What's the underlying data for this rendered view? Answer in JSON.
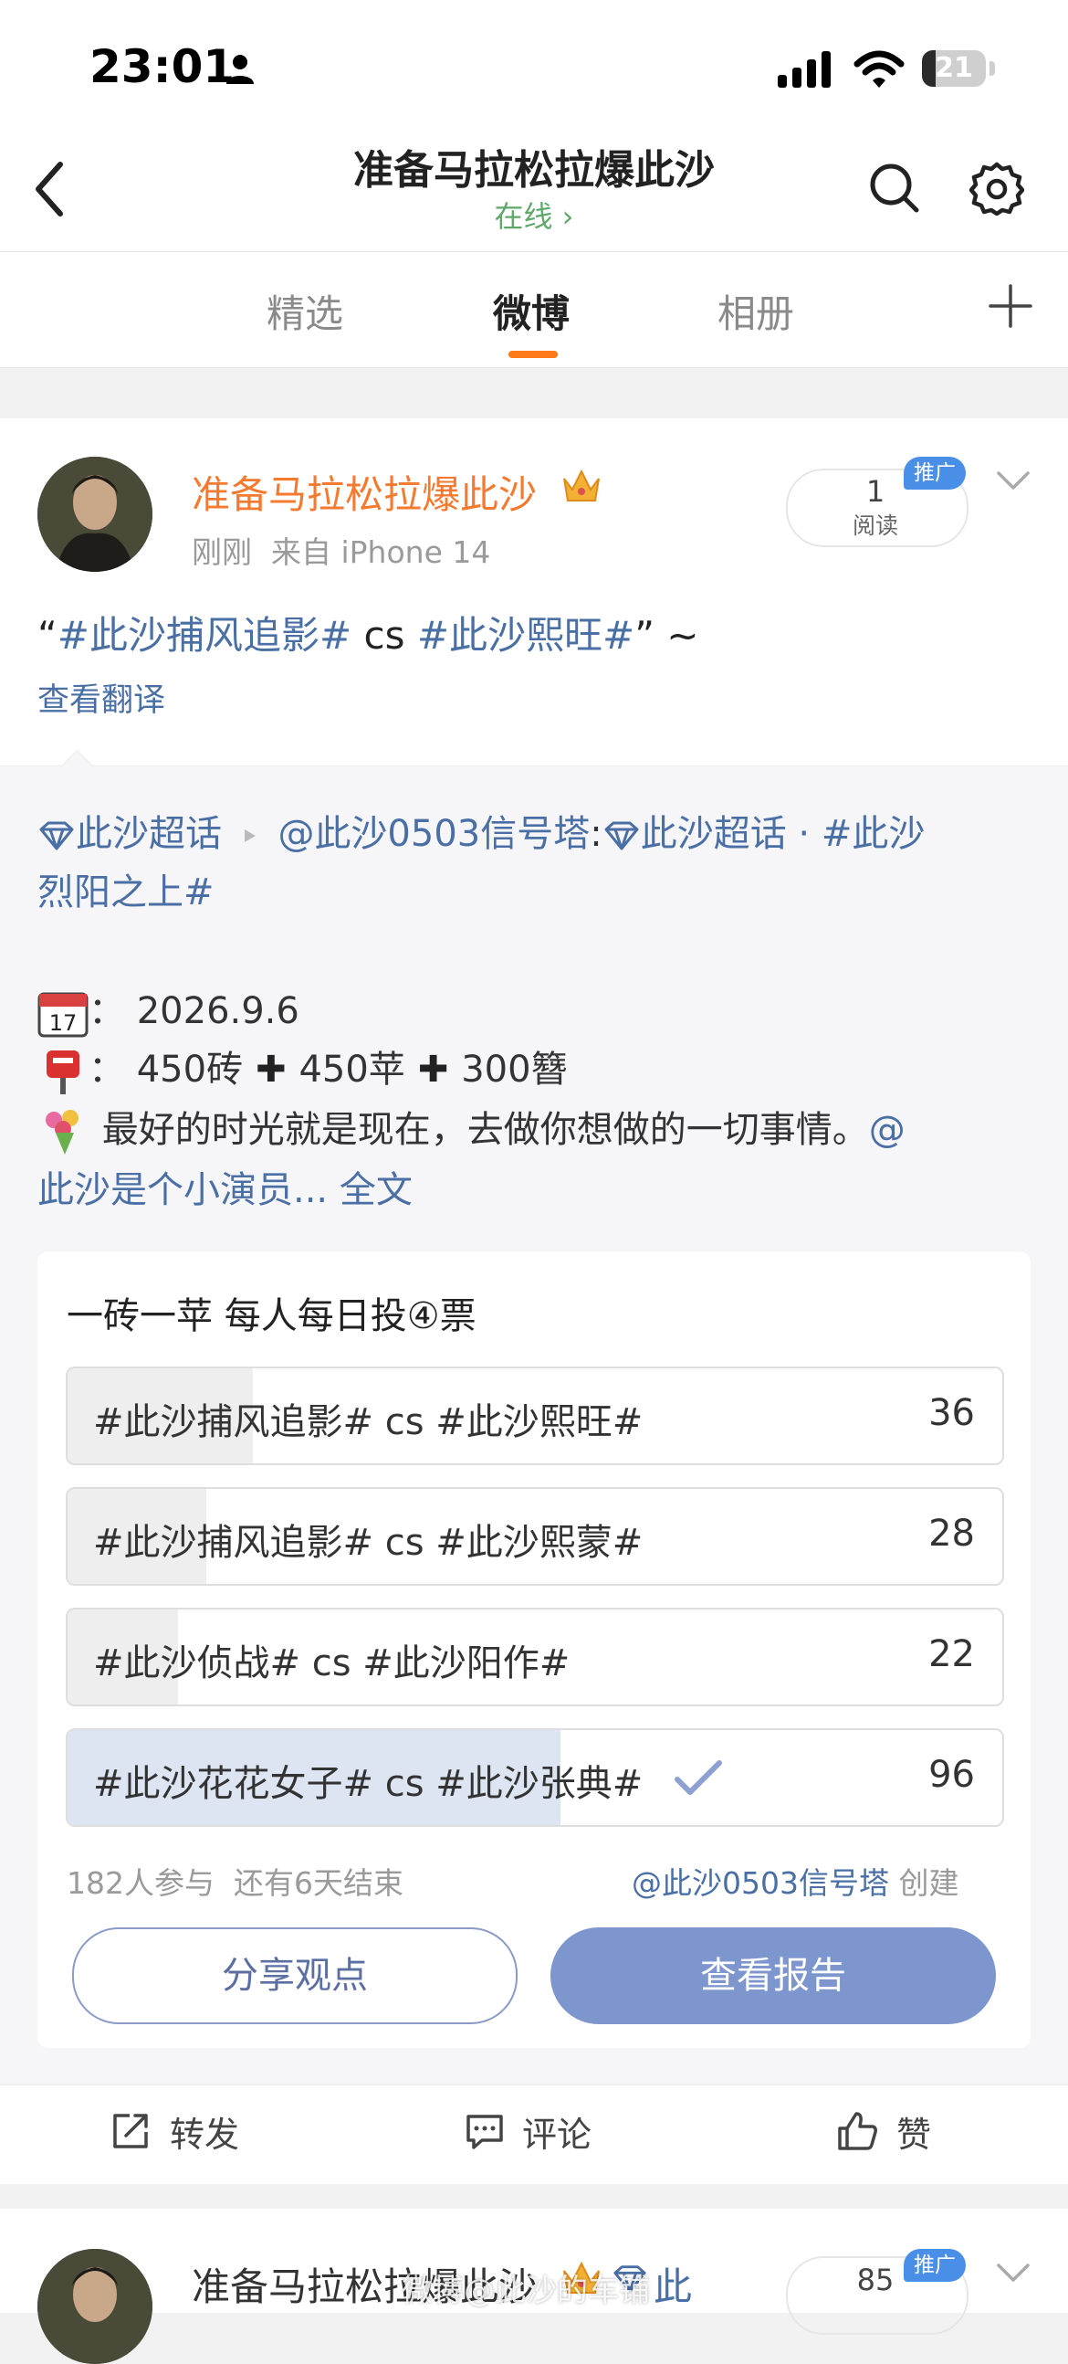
{
  "status_bar": {
    "time": "23:01",
    "battery": "21",
    "battery_level": 0.21
  },
  "nav": {
    "title": "准备马拉松拉爆此沙",
    "status": "在线 ›"
  },
  "tabs": [
    {
      "label": "精选",
      "active": false
    },
    {
      "label": "微博",
      "active": true
    },
    {
      "label": "相册",
      "active": false
    }
  ],
  "post": {
    "username": "准备马拉松拉爆此沙",
    "time": "刚刚",
    "source": "来自 iPhone 14",
    "read_count": "1",
    "read_label": "阅读",
    "promo_badge": "推广",
    "text_open": "“",
    "text_hash1": "#此沙捕风追影#",
    "text_mid": " cs ",
    "text_hash2": "#此沙熙旺#",
    "text_close": "” ~",
    "translate": "查看翻译"
  },
  "repost": {
    "topic": "此沙超话",
    "author": "@此沙0503信号塔",
    "colon": ":",
    "topic2": "此沙超话",
    "dot": " · ",
    "hashtag": "#此沙",
    "hashtag_cont": "烈阳之上#",
    "date_sep": "：",
    "date": "2026.9.6",
    "reward_sep": "：",
    "reward_a": "450砖",
    "reward_b": "450苹",
    "reward_c": "300簪",
    "quote": "最好的时光就是现在，去做你想做的一切事情。",
    "mention_start": "@",
    "mention_rest": "此沙是个小演员...",
    "full_text": "全文"
  },
  "poll": {
    "title": "一砖一苹 每人每日投④票",
    "options": [
      {
        "label": "#此沙捕风追影# cs #此沙熙旺#",
        "count": "36",
        "fraction": 0.198,
        "voted": false
      },
      {
        "label": "#此沙捕风追影# cs #此沙熙蒙#",
        "count": "28",
        "fraction": 0.148,
        "voted": false
      },
      {
        "label": "#此沙侦战# cs #此沙阳作#",
        "count": "22",
        "fraction": 0.118,
        "voted": false
      },
      {
        "label": "#此沙花花女子# cs #此沙张典#",
        "count": "96",
        "fraction": 0.527,
        "voted": true
      }
    ],
    "participants": "182人参与",
    "remaining": "还有6天结束",
    "creator": "@此沙0503信号塔",
    "creator_suffix": "创建",
    "share_button": "分享观点",
    "report_button": "查看报告"
  },
  "actions": {
    "repost": "转发",
    "comment": "评论",
    "like": "赞"
  },
  "next_post": {
    "username": "准备马拉松拉爆此沙",
    "username_tail": "此",
    "read_count": "85",
    "promo_badge": "推广",
    "watermark": "微博@此沙的车铺"
  },
  "colors": {
    "accent": "#ff7a1a",
    "link": "#4a6fa5",
    "button": "#7e96ce"
  }
}
